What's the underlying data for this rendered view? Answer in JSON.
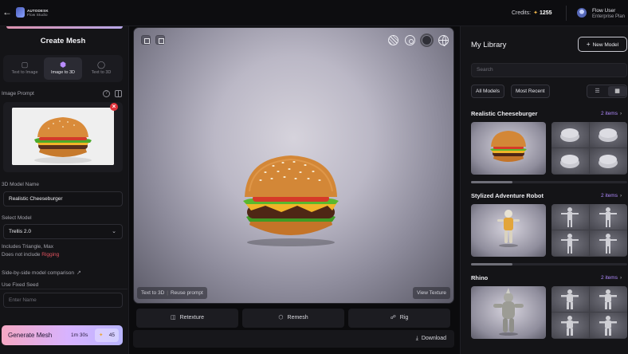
{
  "header": {
    "brand_line1": "AUTODESK",
    "brand_line2": "Flow Studio",
    "credits_label": "Credits:",
    "credits_value": "1255",
    "user_name": "Flow User",
    "user_plan": "Enterprise Plan"
  },
  "left_panel": {
    "title": "Create Mesh",
    "modes": [
      {
        "label": "Text to Image",
        "icon": "cube-outline-icon",
        "active": false
      },
      {
        "label": "Image to 3D",
        "icon": "cube-color-icon",
        "active": true
      },
      {
        "label": "Text to 3D",
        "icon": "sneaker-icon",
        "active": false
      }
    ],
    "image_prompt_label": "Image Prompt",
    "model_name_label": "3D Model Name",
    "model_name_value": "Realistic Cheeseburger",
    "select_model_label": "Select Model",
    "select_model_value": "Trellis 2.0",
    "includes_note": "Includes Triangle, Max",
    "excludes_prefix": "Does not include",
    "excludes_item": "Rigging",
    "comparison_label": "Side-by-side model comparison",
    "seed_label": "Use Fixed Seed",
    "seed_placeholder": "Enter Name",
    "generate_label": "Generate Mesh",
    "generate_time": "1m 30s",
    "generate_cost": "45"
  },
  "viewport": {
    "prompt_source": "Text to 3D",
    "reuse_prompt": "Reuse prompt",
    "view_texture": "View Texture"
  },
  "tools": {
    "retexture": "Retexture",
    "remesh": "Remesh",
    "rig": "Rig",
    "download": "Download"
  },
  "library": {
    "title": "My Library",
    "new_model": "New Model",
    "search_placeholder": "Search",
    "filter_all": "All Models",
    "filter_sort": "Most Recent",
    "sections": [
      {
        "title": "Realistic Cheeseburger",
        "count": "2 items"
      },
      {
        "title": "Stylized Adventure Robot",
        "count": "2 items"
      },
      {
        "title": "Rhino",
        "count": "2 items"
      }
    ]
  },
  "colors": {
    "accent_purple": "#b18bff",
    "generate_gradient_start": "#f5a8c4",
    "generate_gradient_end": "#b9b5ff",
    "alert_red": "#e0323a",
    "credit_star": "#f2b84b"
  }
}
